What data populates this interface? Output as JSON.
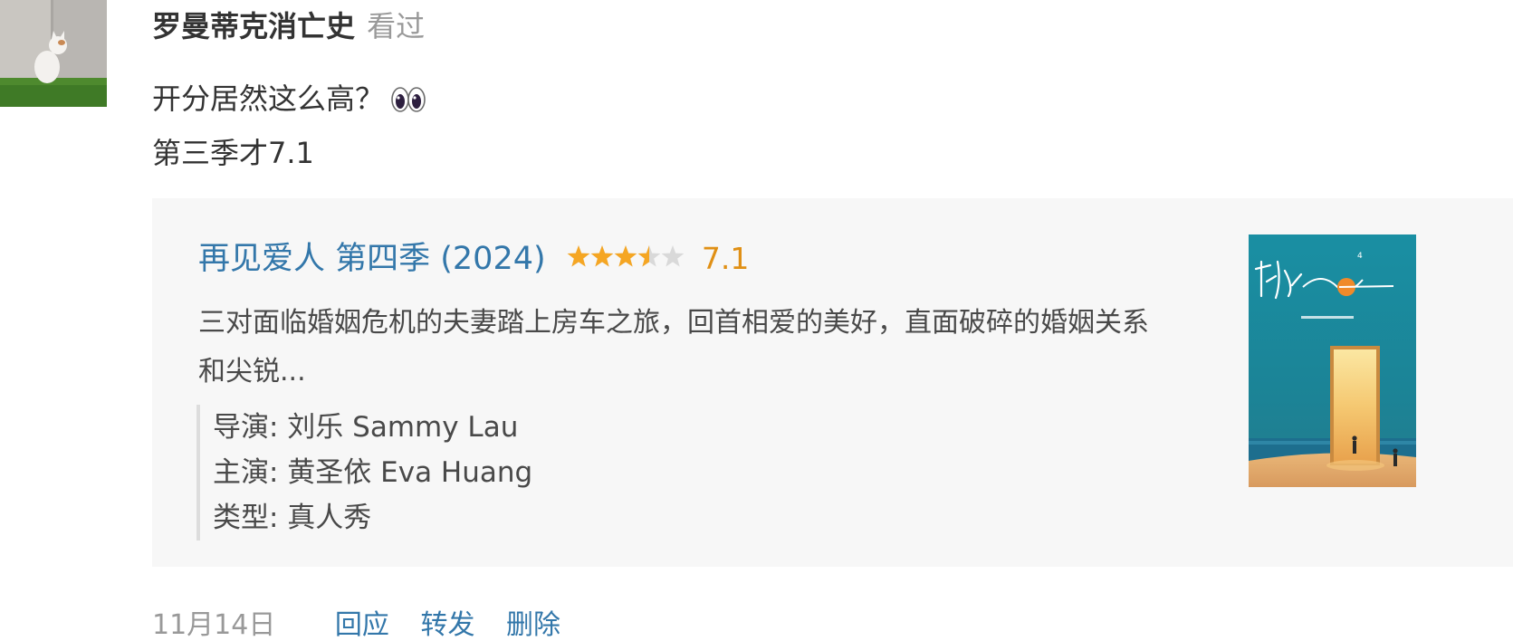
{
  "status": {
    "author": "罗曼蒂克消亡史",
    "verb": "看过",
    "text_lines": [
      "开分居然这么高？",
      "第三季才7.1"
    ],
    "emoji": "eyes-emoji"
  },
  "card": {
    "title": "再见爱人 第四季 (2024)",
    "rating_stars": 3.5,
    "rating_stars_max": 5,
    "rating_value": "7.1",
    "description": "三对面临婚姻危机的夫妻踏上房车之旅，回首相爱的美好，直面破碎的婚姻关系和尖锐...",
    "meta": {
      "director": "导演: 刘乐 Sammy Lau",
      "cast": "主演: 黄圣依 Eva Huang",
      "genre": "类型: 真人秀"
    },
    "poster_icon": "poster-image"
  },
  "footer": {
    "date": "11月14日",
    "actions": [
      "回应",
      "转发",
      "删除"
    ]
  },
  "colors": {
    "link": "#3377aa",
    "star": "#f5a623",
    "rating": "#e09015",
    "card_bg": "#f7f7f7",
    "muted": "#999999"
  }
}
